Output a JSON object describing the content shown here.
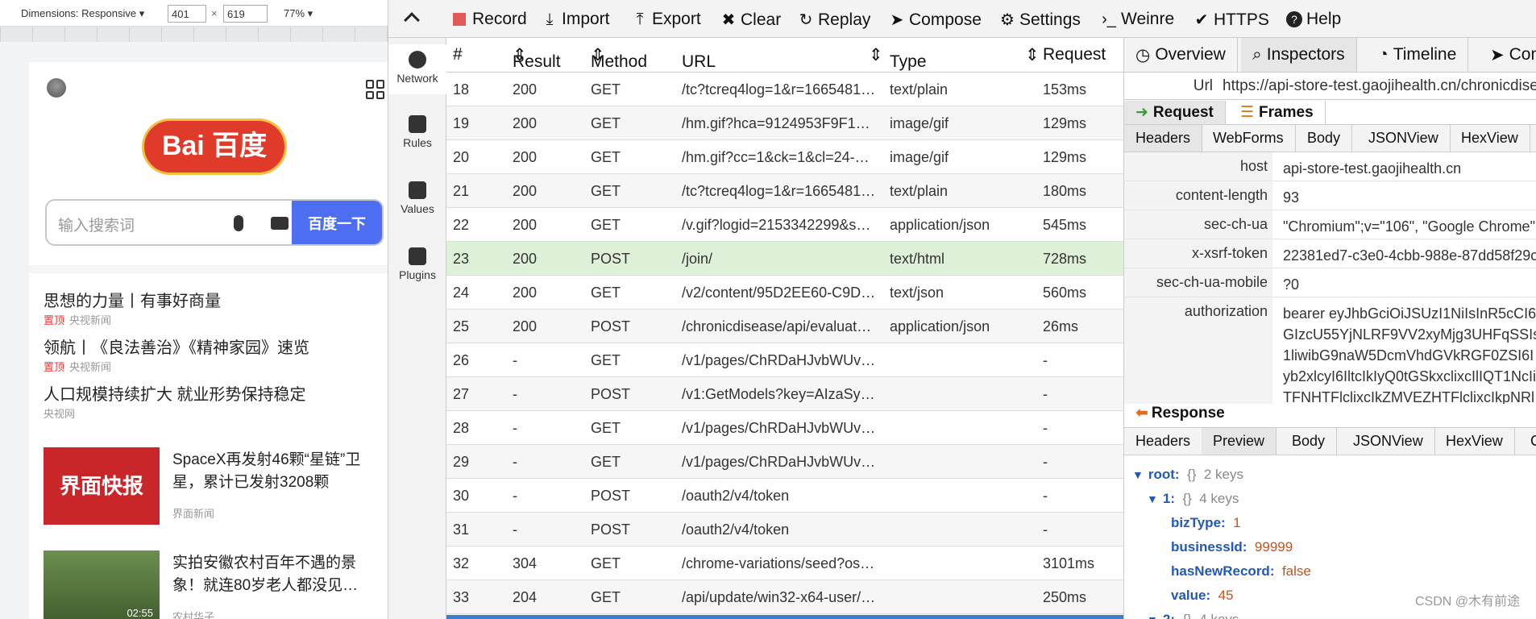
{
  "device_toolbar": {
    "dimensions_label": "Dimensions: Responsive",
    "width": "401",
    "height": "619",
    "times": "×",
    "zoom": "77%"
  },
  "mobile": {
    "logo_text": "Bai 百度",
    "search_placeholder": "输入搜索词",
    "search_button": "百度一下",
    "news": [
      {
        "title": "思想的力量丨有事好商量",
        "tag": "置顶",
        "source": "央视新闻"
      },
      {
        "title": "领航丨《良法善治》《精神家园》速览",
        "tag": "置顶",
        "source": "央视新闻"
      },
      {
        "title": "人口规模持续扩大 就业形势保持稳定",
        "tag": "",
        "source": "央视网"
      }
    ],
    "cards": [
      {
        "image_text": "界面快报",
        "title": "SpaceX再发射46颗“星链”卫星，累计已发射3208颗",
        "source": "界面新闻"
      },
      {
        "image_text": "02:55",
        "title": "实拍安徽农村百年不遇的景象！就连80岁老人都没见…",
        "source": "农村华子"
      }
    ]
  },
  "toolbar": {
    "items": [
      {
        "label": "Record",
        "icon": "record-icon"
      },
      {
        "label": "Import",
        "icon": "import-icon"
      },
      {
        "label": "Export",
        "icon": "export-icon"
      },
      {
        "label": "Clear",
        "icon": "clear-icon"
      },
      {
        "label": "Replay",
        "icon": "replay-icon"
      },
      {
        "label": "Compose",
        "icon": "compose-icon"
      },
      {
        "label": "Settings",
        "icon": "gear-icon"
      },
      {
        "label": "Weinre",
        "icon": "terminal-icon"
      },
      {
        "label": "HTTPS",
        "icon": "check-icon"
      },
      {
        "label": "Help",
        "icon": "help-icon"
      }
    ],
    "record_color": "#e05a5a"
  },
  "sidebar": {
    "items": [
      {
        "label": "Network"
      },
      {
        "label": "Rules"
      },
      {
        "label": "Values"
      },
      {
        "label": "Plugins"
      }
    ]
  },
  "table": {
    "headers": [
      "#",
      "Result",
      "Method",
      "URL",
      "Type",
      "Request"
    ],
    "rows": [
      {
        "id": "18",
        "result": "200",
        "method": "GET",
        "url": "/tc?tcreq4log=1&r=1665481…",
        "type": "text/plain",
        "time": "153ms"
      },
      {
        "id": "19",
        "result": "200",
        "method": "GET",
        "url": "/hm.gif?hca=9124953F9F1…",
        "type": "image/gif",
        "time": "129ms"
      },
      {
        "id": "20",
        "result": "200",
        "method": "GET",
        "url": "/hm.gif?cc=1&ck=1&cl=24-…",
        "type": "image/gif",
        "time": "129ms"
      },
      {
        "id": "21",
        "result": "200",
        "method": "GET",
        "url": "/tc?tcreq4log=1&r=1665481…",
        "type": "text/plain",
        "time": "180ms"
      },
      {
        "id": "22",
        "result": "200",
        "method": "GET",
        "url": "/v.gif?logid=2153342299&s…",
        "type": "application/json",
        "time": "545ms"
      },
      {
        "id": "23",
        "result": "200",
        "method": "POST",
        "url": "/join/",
        "type": "text/html",
        "time": "728ms"
      },
      {
        "id": "24",
        "result": "200",
        "method": "GET",
        "url": "/v2/content/95D2EE60-C9D…",
        "type": "text/json",
        "time": "560ms"
      },
      {
        "id": "25",
        "result": "200",
        "method": "POST",
        "url": "/chronicdisease/api/evaluat…",
        "type": "application/json",
        "time": "26ms"
      },
      {
        "id": "26",
        "result": "-",
        "method": "GET",
        "url": "/v1/pages/ChRDaHJvbWUv…",
        "type": "",
        "time": "-"
      },
      {
        "id": "27",
        "result": "-",
        "method": "POST",
        "url": "/v1:GetModels?key=AIzaSy…",
        "type": "",
        "time": "-"
      },
      {
        "id": "28",
        "result": "-",
        "method": "GET",
        "url": "/v1/pages/ChRDaHJvbWUv…",
        "type": "",
        "time": "-"
      },
      {
        "id": "29",
        "result": "-",
        "method": "GET",
        "url": "/v1/pages/ChRDaHJvbWUv…",
        "type": "",
        "time": "-"
      },
      {
        "id": "30",
        "result": "-",
        "method": "POST",
        "url": "/oauth2/v4/token",
        "type": "",
        "time": "-"
      },
      {
        "id": "31",
        "result": "-",
        "method": "POST",
        "url": "/oauth2/v4/token",
        "type": "",
        "time": "-"
      },
      {
        "id": "32",
        "result": "304",
        "method": "GET",
        "url": "/chrome-variations/seed?os…",
        "type": "",
        "time": "3101ms"
      },
      {
        "id": "33",
        "result": "204",
        "method": "GET",
        "url": "/api/update/win32-x64-user/…",
        "type": "",
        "time": "250ms"
      }
    ],
    "selected_color": "#dff0d8"
  },
  "panel": {
    "tabs": [
      {
        "label": "Overview"
      },
      {
        "label": "Inspectors"
      },
      {
        "label": "Timeline"
      },
      {
        "label": "Com"
      }
    ],
    "url_key": "Url",
    "url_value": "https://api-store-test.gaojihealth.cn/chronicdisease",
    "request_tabs": [
      {
        "label": "Request"
      },
      {
        "label": "Frames"
      }
    ],
    "sub_tabs": [
      "Headers",
      "WebForms",
      "Body",
      "JSONView",
      "HexView"
    ],
    "headers": [
      {
        "k": "host",
        "v": "api-store-test.gaojihealth.cn"
      },
      {
        "k": "content-length",
        "v": "93"
      },
      {
        "k": "sec-ch-ua",
        "v": "\"Chromium\";v=\"106\", \"Google Chrome\""
      },
      {
        "k": "x-xsrf-token",
        "v": "22381ed7-c3e0-4cbb-988e-87dd58f29c"
      },
      {
        "k": "sec-ch-ua-mobile",
        "v": "?0"
      },
      {
        "k": "authorization",
        "v": [
          "bearer eyJhbGciOiJSUzI1NiIsInR5cCI6",
          "GIzcU55YjNLRF9VV2xyMjg3UHFqSSIs",
          "1liwibG9naW5DcmVhdGVkRGF0ZSI6I",
          "yb2xlcyI6IltcIkIyQ0tGSkxclixcIlIQT1NcIi",
          "TFNHTFlclixcIkZMVEZHTFlclixcIkpNRl"
        ]
      }
    ],
    "response_label": "Response",
    "response_tabs": [
      "Headers",
      "Preview",
      "Body",
      "JSONView",
      "HexView",
      "C"
    ],
    "tree": {
      "root_key": "root:",
      "root_type": "{}",
      "root_count": "2 keys",
      "child_key": "1:",
      "child_type": "{}",
      "child_count": "4 keys",
      "fields": [
        {
          "k": "bizType:",
          "v": "1"
        },
        {
          "k": "businessId:",
          "v": "99999"
        },
        {
          "k": "hasNewRecord:",
          "v": "false"
        },
        {
          "k": "value:",
          "v": "45"
        }
      ],
      "next_key": "2:",
      "next_type": "{}",
      "next_count": "4 keys"
    }
  },
  "watermark": "CSDN @木有前途"
}
